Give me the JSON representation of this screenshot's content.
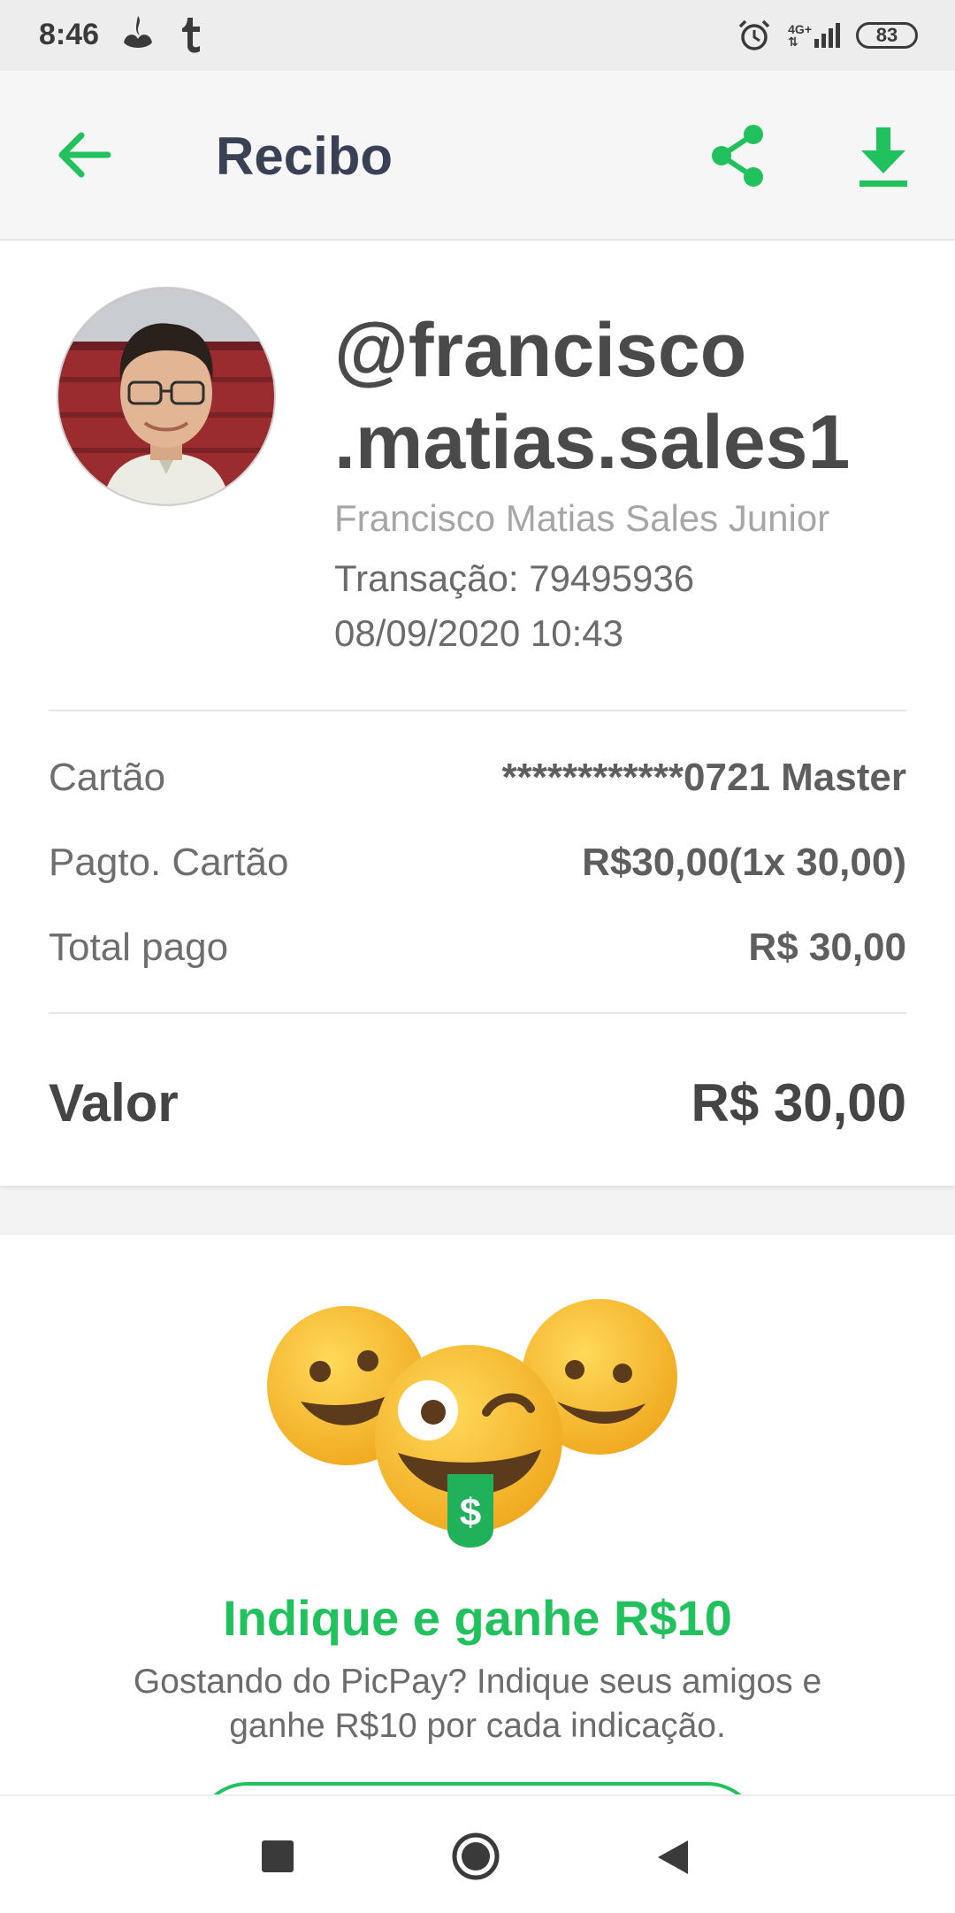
{
  "status_bar": {
    "time": "8:46",
    "network": "4G+",
    "battery": "83",
    "icons": [
      "santander-icon",
      "tumblr-icon",
      "alarm-icon",
      "signal-icon",
      "battery-icon"
    ]
  },
  "app_bar": {
    "title": "Recibo",
    "icons": [
      "back-arrow-icon",
      "share-icon",
      "download-icon"
    ]
  },
  "colors": {
    "accent": "#21c25e",
    "title": "#3b4155"
  },
  "receipt": {
    "username": "@francisco .matias.sales1",
    "full_name": "Francisco Matias Sales Junior",
    "transaction": "Transação: 79495936",
    "datetime": "08/09/2020 10:43",
    "rows": [
      {
        "label": "Cartão",
        "value": "************0721 Master"
      },
      {
        "label": "Pagto. Cartão",
        "value": "R$30,00(1x 30,00)"
      },
      {
        "label": "Total pago",
        "value": "R$ 30,00"
      }
    ],
    "valor_label": "Valor",
    "valor_value": "R$ 30,00"
  },
  "promo": {
    "title": "Indique e ganhe R$10",
    "text": "Gostando do PicPay? Indique seus amigos e ganhe R$10 por cada indicação.",
    "coin_symbol": "$"
  },
  "nav": {
    "icons": [
      "recents-icon",
      "home-icon",
      "back-icon"
    ]
  }
}
